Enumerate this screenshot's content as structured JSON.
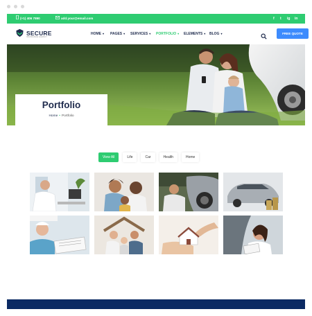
{
  "topbar": {
    "phone": "(+1) 406 7890",
    "email": "add.your@email.com",
    "social": [
      "f",
      "t",
      "ig",
      "in"
    ]
  },
  "brand": {
    "name": "SECURE",
    "tagline": "INSURANCE AGENCY"
  },
  "nav": {
    "items": [
      "HOME",
      "PAGES",
      "SERVICES",
      "PORTFOLIO",
      "ELEMENTS",
      "BLOG"
    ],
    "active": "PORTFOLIO",
    "cta": "FREE QUOTE"
  },
  "hero": {
    "title": "Portfolio",
    "breadcrumb": {
      "home": "Home",
      "current": "Portfolio"
    }
  },
  "filters": {
    "items": [
      "View All",
      "Life",
      "Car",
      "Health",
      "Home"
    ],
    "active": "View All"
  },
  "gallery": {
    "tiles": [
      "doctor-at-desk",
      "family-on-couch",
      "man-with-car-damage",
      "silver-car",
      "nurse-with-document",
      "family-under-roof",
      "hands-holding-house",
      "woman-in-car"
    ]
  },
  "colors": {
    "accent": "#2ecc71",
    "navy": "#1f2b4d",
    "button": "#3d8bfd",
    "footer": "#0b2a63"
  }
}
